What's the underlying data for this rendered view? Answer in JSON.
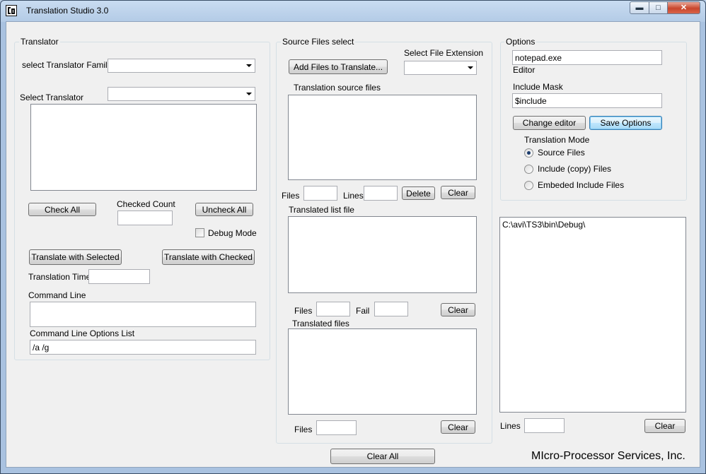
{
  "window": {
    "title": "Translation Studio 3.0",
    "icon": "app-logo-icon"
  },
  "translator": {
    "group_title": "Translator",
    "family_label": "select Translator  Family",
    "family_value": "",
    "select_label": "Select Translator",
    "select_value": "",
    "check_all": "Check All",
    "checked_count_label": "Checked Count",
    "checked_count_value": "",
    "uncheck_all": "Uncheck All",
    "debug_mode": "Debug Mode",
    "translate_selected": "Translate  with  Selected",
    "translate_checked": "Translate with Checked",
    "translation_time_label": "Translation Time",
    "translation_time_value": "",
    "command_line_label": "Command Line",
    "command_line_value": "",
    "options_list_label": "Command Line Options List",
    "options_list_value": "/a /g"
  },
  "source": {
    "group_title": "Source Files select",
    "add_files": "Add Files to Translate...",
    "file_ext_label": "Select File Extension",
    "file_ext_value": "",
    "source_files_label": "Translation source files",
    "files_label": "Files",
    "files_value": "",
    "lines_label": "Lines",
    "lines_value": "",
    "delete": "Delete",
    "clear": "Clear",
    "translated_list_label": "Translated list file",
    "tl_files_label": "Files",
    "tl_files_value": "",
    "tl_fail_label": "Fail",
    "tl_fail_value": "",
    "tl_clear": "Clear",
    "translated_files_label": "Translated files",
    "tf_files_label": "Files",
    "tf_files_value": "",
    "tf_clear": "Clear"
  },
  "options": {
    "group_title": "Options",
    "editor_value": "notepad.exe",
    "editor_label": "Editor",
    "include_mask_label": "Include Mask",
    "include_mask_value": "$include",
    "change_editor": "Change editor",
    "save_options": "Save Options",
    "mode_label": "Translation Mode",
    "modes": [
      "Source Files",
      "Include (copy) Files",
      "Embeded Include Files"
    ],
    "selected_mode": 0
  },
  "output": {
    "text": "C:\\avi\\TS3\\bin\\Debug\\",
    "lines_label": "Lines",
    "lines_value": "",
    "clear": "Clear"
  },
  "footer": {
    "clear_all": "Clear All",
    "company": "MIcro-Processor Services, Inc."
  }
}
